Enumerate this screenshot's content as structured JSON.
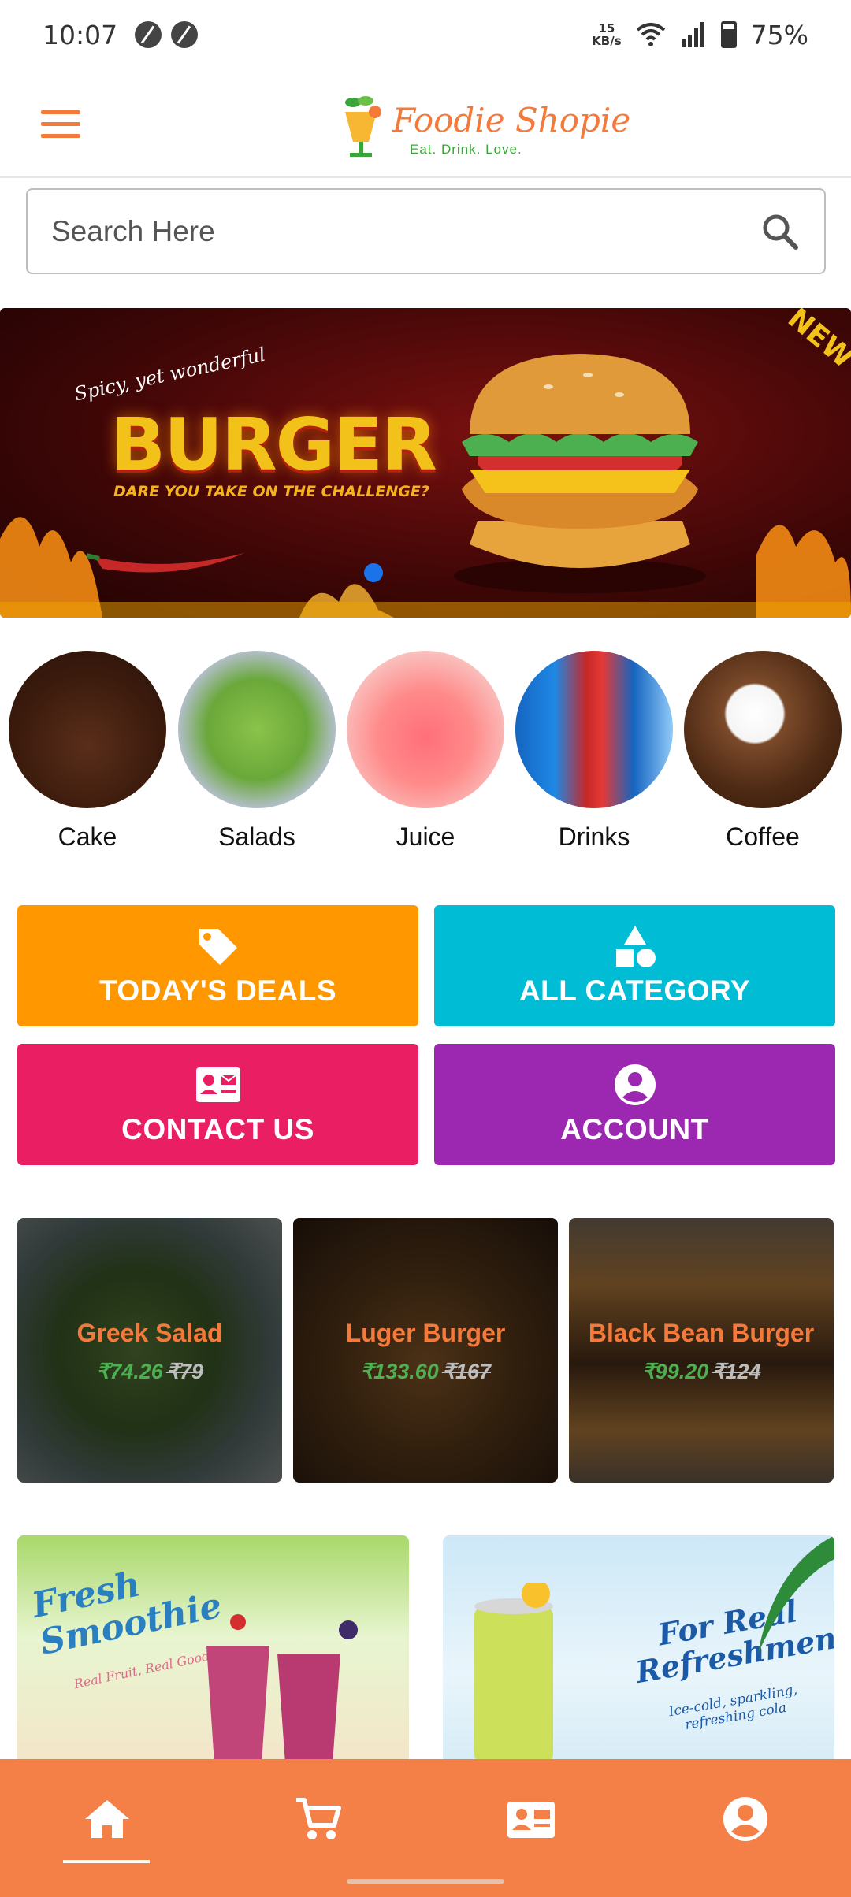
{
  "status_bar": {
    "time": "10:07",
    "speed_value": "15",
    "speed_unit": "KB/s",
    "battery": "75%"
  },
  "header": {
    "logo_title": "Foodie Shopie",
    "logo_tagline": "Eat. Drink. Love."
  },
  "search": {
    "placeholder": "Search Here"
  },
  "banner": {
    "tagline": "Spicy, yet wonderful",
    "title": "BURGER",
    "subtitle": "DARE YOU TAKE ON THE CHALLENGE?",
    "badge": "NEW"
  },
  "categories": [
    {
      "label": "Cake"
    },
    {
      "label": "Salads"
    },
    {
      "label": "Juice"
    },
    {
      "label": "Drinks"
    },
    {
      "label": "Coffee"
    }
  ],
  "tiles": {
    "deals": "TODAY'S DEALS",
    "all_category": "ALL CATEGORY",
    "contact": "CONTACT US",
    "account": "ACCOUNT"
  },
  "products": [
    {
      "name": "Greek Salad",
      "price": "₹74.26",
      "old_price": "₹79"
    },
    {
      "name": "Luger Burger",
      "price": "₹133.60",
      "old_price": "₹167"
    },
    {
      "name": "Black Bean Burger",
      "price": "₹99.20",
      "old_price": "₹124"
    }
  ],
  "promos": {
    "smoothie_title": "Fresh Smoothie",
    "smoothie_sub": "Real Fruit, Real Good !",
    "soda_title": "For Real Refreshment!",
    "soda_sub": "Ice-cold, sparkling, refreshing cola"
  },
  "colors": {
    "brand": "#f47a3c",
    "deals": "#ff9800",
    "all_category": "#00bcd4",
    "contact": "#e91e63",
    "account": "#9c27b0",
    "nav": "#f47f47"
  },
  "nav": [
    "home-icon",
    "cart-icon",
    "contact-card-icon",
    "account-icon"
  ]
}
